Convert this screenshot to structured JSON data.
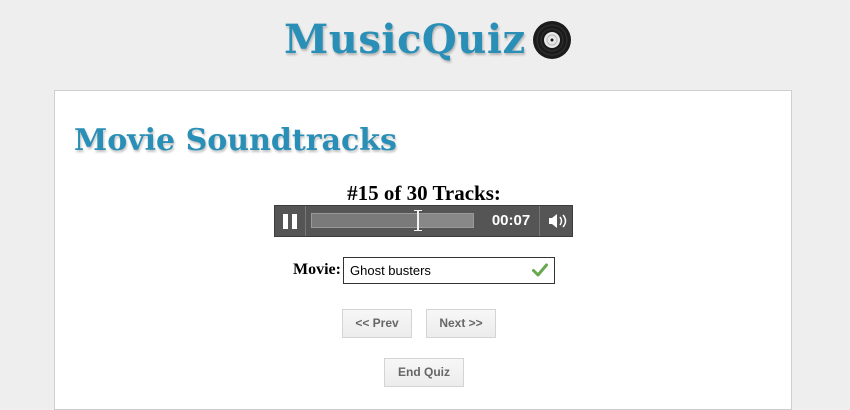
{
  "header": {
    "logo_text": "MusicQuiz",
    "logo_icon": "vinyl-record-icon",
    "brand_color": "#2a8fb6"
  },
  "quiz": {
    "title": "Movie Soundtracks",
    "track_counter": "#15 of 30 Tracks:"
  },
  "player": {
    "pause_icon": "pause-icon",
    "progress_fraction": 0.66,
    "time": "00:07",
    "volume_icon": "volume-icon"
  },
  "answer": {
    "label": "Movie:",
    "value": "Ghost busters",
    "status_icon": "check-icon",
    "status_color": "#6aa84f"
  },
  "nav": {
    "prev_label": "<< Prev",
    "next_label": "Next >>",
    "end_label": "End Quiz"
  }
}
